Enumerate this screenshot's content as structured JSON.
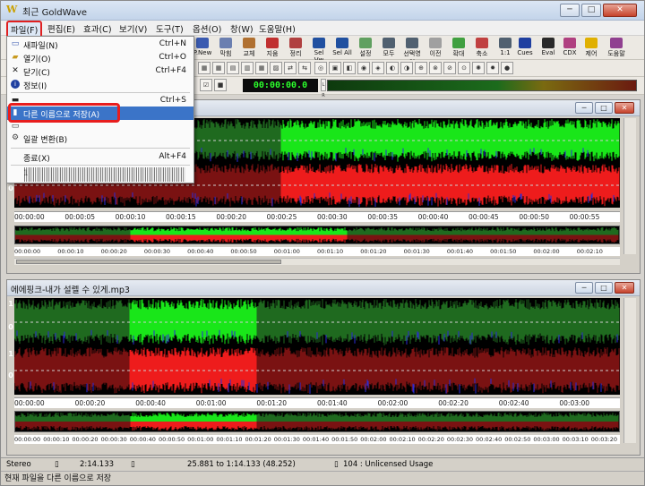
{
  "app": {
    "title": "최근 GoldWave",
    "icon": "goldwave-logo-icon"
  },
  "window_controls": {
    "minimize": "─",
    "maximize": "□",
    "close": "✕"
  },
  "menubar": {
    "items": [
      "파일(F)",
      "편집(E)",
      "효과(C)",
      "보기(V)",
      "도구(T)",
      "옵션(O)",
      "창(W)",
      "도움말(H)"
    ]
  },
  "toolbar1": {
    "buttons": [
      "P.New",
      "막힘",
      "교체",
      "지움",
      "정리",
      "Sel Vw",
      "Sel All",
      "설정",
      "모두",
      "선택영역",
      "이전",
      "확대",
      "축소",
      "1:1",
      "Cues",
      "Eval",
      "CDX",
      "제어",
      "도움말"
    ]
  },
  "toolbar3": {
    "time_readout": "00:00:00.0",
    "meter_label": "L R"
  },
  "file_menu": {
    "items": [
      {
        "label": "새파일(N)",
        "shortcut": "Ctrl+N",
        "icon": "new-file-icon"
      },
      {
        "label": "열기(O)",
        "shortcut": "Ctrl+O",
        "icon": "open-folder-icon"
      },
      {
        "label": "닫기(C)",
        "shortcut": "Ctrl+F4",
        "icon": "close-x-icon"
      },
      {
        "label": "정보(I)",
        "shortcut": "",
        "icon": "info-icon"
      },
      {
        "label": "",
        "shortcut": "Ctrl+S",
        "icon": "save-icon"
      },
      {
        "label": "다른 이름으로 저장(A)",
        "shortcut": "",
        "icon": "save-as-icon"
      },
      {
        "label": "",
        "shortcut": "",
        "icon": "batch-icon"
      },
      {
        "label": "일괄 변환(B)",
        "shortcut": "",
        "icon": "batch-convert-icon"
      },
      {
        "label": "종료(X)",
        "shortcut": "Alt+F4",
        "icon": ""
      },
      {
        "label": "1",
        "shortcut": "",
        "icon": ""
      }
    ]
  },
  "wave_window1": {
    "title": "",
    "ruler": [
      "00:00:00",
      "00:00:05",
      "00:00:10",
      "00:00:15",
      "00:00:20",
      "00:00:25",
      "00:00:30",
      "00:00:35",
      "00:00:40",
      "00:00:45",
      "00:00:50",
      "00:00:55"
    ],
    "overview_ruler": [
      "00:00:00",
      "00:00:10",
      "00:00:20",
      "00:00:30",
      "00:00:40",
      "00:00:50",
      "00:01:00",
      "00:01:10",
      "00:01:20",
      "00:01:30",
      "00:01:40",
      "00:01:50",
      "00:02:00",
      "00:02:10"
    ],
    "channel_labels": [
      "1",
      "0",
      "1",
      "0"
    ],
    "colors": {
      "left_channel": "#19e619",
      "right_channel": "#ee1c1c",
      "left_dim": "#1f6a1f",
      "right_dim": "#7a1212",
      "background": "#000000",
      "peak": "#2b2bd6"
    }
  },
  "wave_window2": {
    "title": "에에핑크-내가 설렐 수 있게.mp3",
    "ruler": [
      "00:00:00",
      "00:00:20",
      "00:00:40",
      "00:01:00",
      "00:01:20",
      "00:01:40",
      "00:02:00",
      "00:02:20",
      "00:02:40",
      "00:03:00"
    ],
    "overview_ruler": [
      "00:00:00",
      "00:00:10",
      "00:00:20",
      "00:00:30",
      "00:00:40",
      "00:00:50",
      "00:01:00",
      "00:01:10",
      "00:01:20",
      "00:01:30",
      "00:01:40",
      "00:01:50",
      "00:02:00",
      "00:02:10",
      "00:02:20",
      "00:02:30",
      "00:02:40",
      "00:02:50",
      "00:03:00",
      "00:03:10",
      "00:03:20"
    ],
    "channel_labels": [
      "1",
      "0",
      "1",
      "0"
    ]
  },
  "statusbar": {
    "channels": "Stereo",
    "length": "2:14.133",
    "selection": "25.881 to 1:14.133 (48.252)",
    "license": "104 : Unlicensed Usage",
    "message": "현재 파일을 다른 이름으로 저장"
  }
}
